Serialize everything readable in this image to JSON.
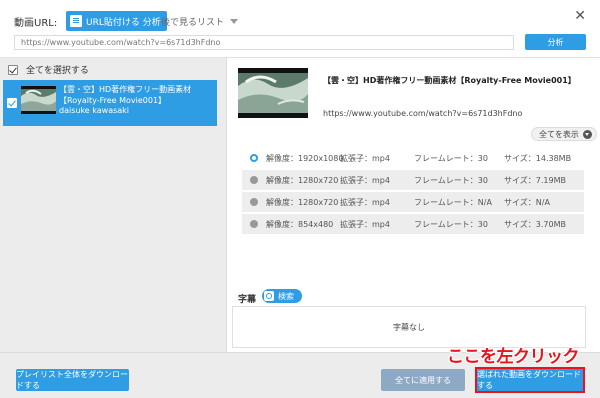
{
  "header": {
    "url_label": "動画URL:",
    "paste_button": "URL貼付ける 分析",
    "later_list": "後で見るリスト",
    "url_value": "https://www.youtube.com/watch?v=6s71d3hFdno",
    "analyze_button": "分析"
  },
  "left": {
    "select_all": "全てを選択する",
    "item": {
      "title": "【雲・空】HD著作権フリー動画素材【Royalty-Free Movie001】",
      "author": "daisuke kawasaki"
    }
  },
  "detail": {
    "title": "【雲・空】HD著作権フリー動画素材【Royalty-Free Movie001】",
    "url": "https://www.youtube.com/watch?v=6s71d3hFdno",
    "show_all": "全てを表示",
    "formats": [
      {
        "res": "解像度：1920x1080",
        "ext": "拡張子：mp4",
        "fps": "フレームレート：30",
        "size": "サイズ：14.38MB"
      },
      {
        "res": "解像度：1280x720",
        "ext": "拡張子：mp4",
        "fps": "フレームレート：30",
        "size": "サイズ：7.19MB"
      },
      {
        "res": "解像度：1280x720",
        "ext": "拡張子：mp4",
        "fps": "フレームレート：N/A",
        "size": "サイズ：N/A"
      },
      {
        "res": "解像度：854x480",
        "ext": "拡張子：mp4",
        "fps": "フレームレート：30",
        "size": "サイズ：3.70MB"
      }
    ],
    "subtitle_label": "字幕",
    "search_button": "検索",
    "no_subtitle": "字幕なし"
  },
  "footer": {
    "playlist_button": "プレイリスト全体をダウンロードする",
    "apply_all_button": "全てに適用する",
    "download_button": "選ばれた動画をダウンロードする"
  },
  "annotation": "ここを左クリック",
  "colors": {
    "accent": "#2f9de4",
    "highlight": "#e8131b"
  }
}
